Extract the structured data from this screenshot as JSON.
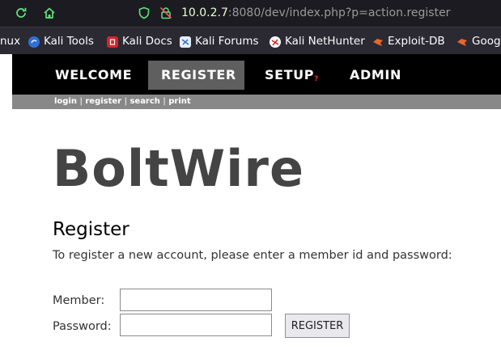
{
  "browser": {
    "url_host": "10.0.2.7",
    "url_path": ":8080/dev/index.php?p=action.register"
  },
  "bookmarks": [
    {
      "label": "nux",
      "icon": "none"
    },
    {
      "label": "Kali Tools",
      "icon": "kali-tools-icon"
    },
    {
      "label": "Kali Docs",
      "icon": "kali-docs-icon"
    },
    {
      "label": "Kali Forums",
      "icon": "kali-forums-icon"
    },
    {
      "label": "Kali NetHunter",
      "icon": "kali-nethunter-icon"
    },
    {
      "label": "Exploit-DB",
      "icon": "exploit-db-icon"
    },
    {
      "label": "Goog",
      "icon": "google-hacking-db-icon"
    }
  ],
  "nav": {
    "items": [
      "WELCOME",
      "REGISTER",
      "SETUP",
      "ADMIN"
    ],
    "setup_marker": "?",
    "active": "REGISTER"
  },
  "subnav": {
    "links": [
      "login",
      "register",
      "search",
      "print"
    ],
    "separator": "|"
  },
  "site_title": "BoltWire",
  "page": {
    "heading": "Register",
    "intro": "To register a new account, please enter a member id and password:"
  },
  "form": {
    "member_label": "Member:",
    "member_value": "",
    "password_label": "Password:",
    "password_value": "",
    "submit_label": "REGISTER"
  },
  "colors": {
    "nav_bg": "#000000",
    "nav_active": "#5f5f5f",
    "subnav_bg": "#888888",
    "title": "#444444"
  }
}
